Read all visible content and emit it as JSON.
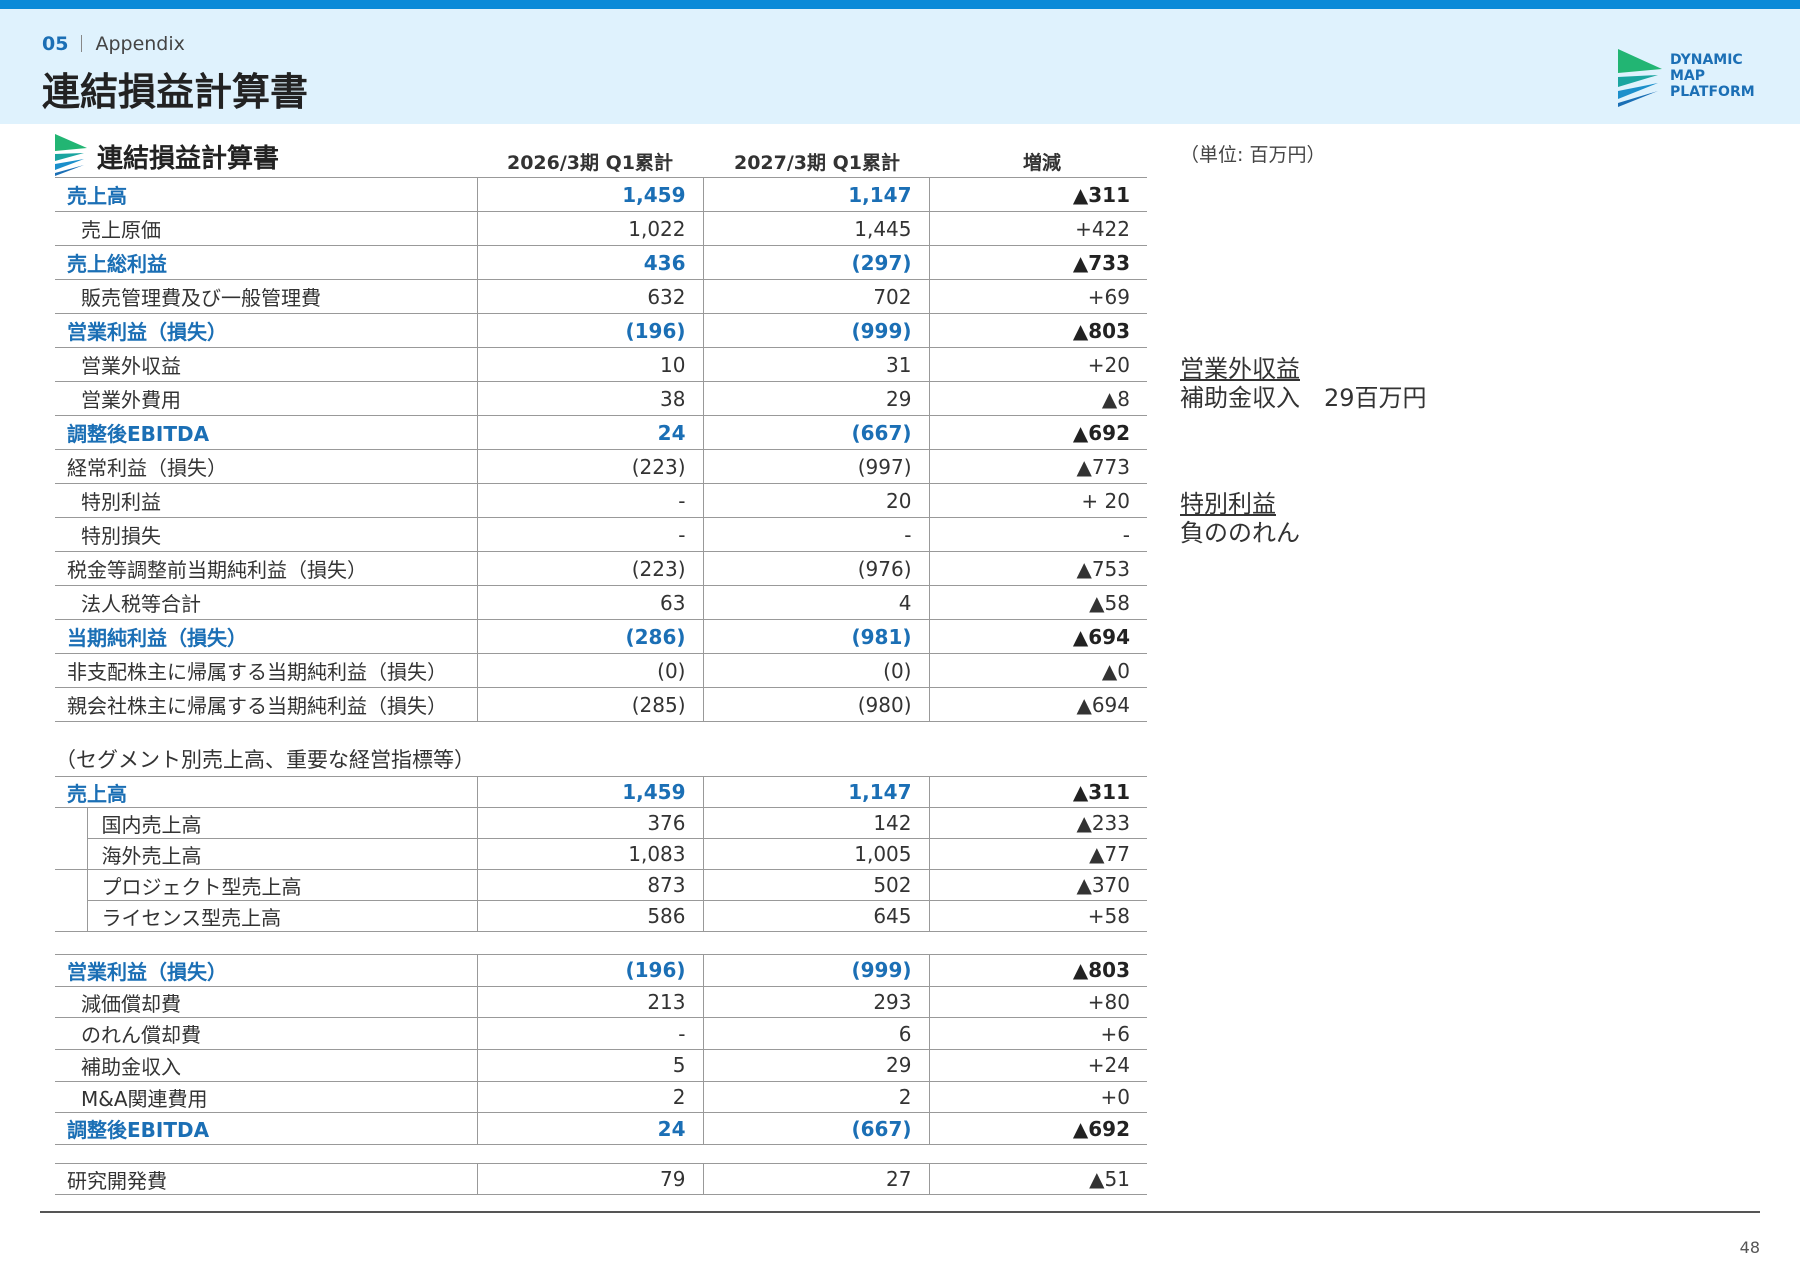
{
  "header": {
    "section_num": "05",
    "section_name": "Appendix",
    "title": "連結損益計算書",
    "logo_lines": [
      "DYNAMIC",
      "MAP",
      "PLATFORM"
    ]
  },
  "colors": {
    "accent": "#1b6fb5",
    "header_bg": "#dff2fd",
    "topbar": "#0a8ad8",
    "logo_green": "#22b573"
  },
  "icons": {
    "logo": "dmp-logo-icon",
    "table_header": "dmp-stripe-icon"
  },
  "table_header": {
    "title": "連結損益計算書",
    "col1": "2026/3期 Q1累計",
    "col2": "2027/3期 Q1累計",
    "col3": "増減"
  },
  "unit": "（単位: 百万円）",
  "notes": {
    "note1_heading": "営業外収益",
    "note1_body": "補助金収入　29百万円",
    "note2_heading": "特別利益",
    "note2_body": "負ののれん"
  },
  "pl_rows": [
    {
      "label": "売上高",
      "v1": "1,459",
      "v2": "1,147",
      "d": "▲311"
    },
    {
      "label": "売上原価",
      "v1": "1,022",
      "v2": "1,445",
      "d": "+422"
    },
    {
      "label": "売上総利益",
      "v1": "436",
      "v2": "(297)",
      "d": "▲733"
    },
    {
      "label": "販売管理費及び一般管理費",
      "v1": "632",
      "v2": "702",
      "d": "+69"
    },
    {
      "label": "営業利益（損失）",
      "v1": "(196)",
      "v2": "(999)",
      "d": "▲803"
    },
    {
      "label": "営業外収益",
      "v1": "10",
      "v2": "31",
      "d": "+20"
    },
    {
      "label": "営業外費用",
      "v1": "38",
      "v2": "29",
      "d": "▲8"
    },
    {
      "label": "調整後EBITDA",
      "v1": "24",
      "v2": "(667)",
      "d": "▲692"
    },
    {
      "label": "経常利益（損失）",
      "v1": "(223)",
      "v2": "(997)",
      "d": "▲773"
    },
    {
      "label": "特別利益",
      "v1": "-",
      "v2": "20",
      "d": "+ 20"
    },
    {
      "label": "特別損失",
      "v1": "-",
      "v2": "-",
      "d": "-"
    },
    {
      "label": "税金等調整前当期純利益（損失）",
      "v1": "(223)",
      "v2": "(976)",
      "d": "▲753"
    },
    {
      "label": "法人税等合計",
      "v1": "63",
      "v2": "4",
      "d": "▲58"
    },
    {
      "label": "当期純利益（損失）",
      "v1": "(286)",
      "v2": "(981)",
      "d": "▲694"
    },
    {
      "label": "非支配株主に帰属する当期純利益（損失）",
      "v1": "(0)",
      "v2": "(0)",
      "d": "▲0"
    },
    {
      "label": "親会社株主に帰属する当期純利益（損失）",
      "v1": "(285)",
      "v2": "(980)",
      "d": "▲694"
    }
  ],
  "segment_label": "（セグメント別売上高、重要な経営指標等）",
  "segment_rows": [
    {
      "label": "売上高",
      "v1": "1,459",
      "v2": "1,147",
      "d": "▲311"
    },
    {
      "label": "国内売上高",
      "v1": "376",
      "v2": "142",
      "d": "▲233"
    },
    {
      "label": "海外売上高",
      "v1": "1,083",
      "v2": "1,005",
      "d": "▲77"
    },
    {
      "label": "プロジェクト型売上高",
      "v1": "873",
      "v2": "502",
      "d": "▲370"
    },
    {
      "label": "ライセンス型売上高",
      "v1": "586",
      "v2": "645",
      "d": "+58"
    }
  ],
  "ebitda_rows": [
    {
      "label": "営業利益（損失）",
      "v1": "(196)",
      "v2": "(999)",
      "d": "▲803"
    },
    {
      "label": "減価償却費",
      "v1": "213",
      "v2": "293",
      "d": "+80"
    },
    {
      "label": "のれん償却費",
      "v1": "-",
      "v2": "6",
      "d": "+6"
    },
    {
      "label": "補助金収入",
      "v1": "5",
      "v2": "29",
      "d": "+24"
    },
    {
      "label": "M&A関連費用",
      "v1": "2",
      "v2": "2",
      "d": "+0"
    },
    {
      "label": "調整後EBITDA",
      "v1": "24",
      "v2": "(667)",
      "d": "▲692"
    }
  ],
  "rd_row": {
    "label": "研究開発費",
    "v1": "79",
    "v2": "27",
    "d": "▲51"
  },
  "page_number": "48"
}
